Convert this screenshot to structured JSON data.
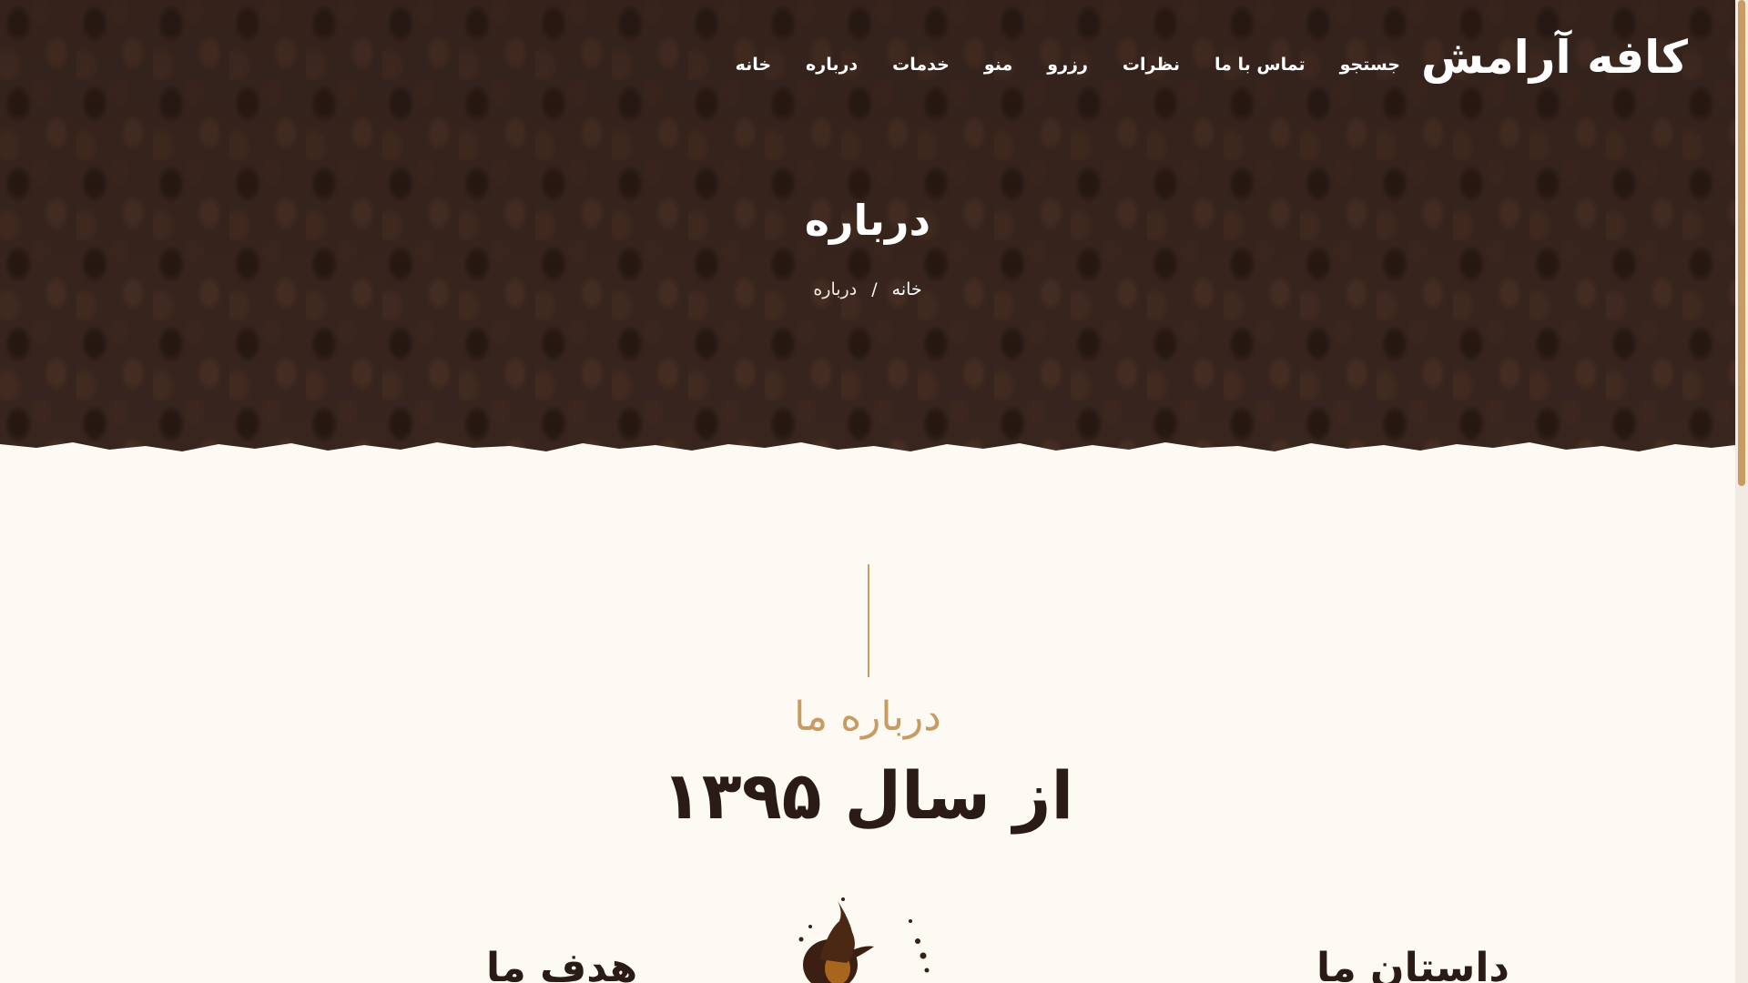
{
  "header": {
    "brand": "کافه آرامش",
    "nav": [
      "خانه",
      "درباره",
      "خدمات",
      "منو",
      "رزرو",
      "نظرات",
      "تماس با ما",
      "جستجو"
    ]
  },
  "hero": {
    "title": "درباره",
    "breadcrumb": {
      "home": "خانه",
      "separator": "/",
      "current": "درباره"
    }
  },
  "about": {
    "kicker": "درباره ما",
    "title": "از سال ۱۳۹۵",
    "col_left_heading": "هدف ما",
    "col_right_heading": "داستان ما"
  },
  "colors": {
    "hero_bg": "#3a2720",
    "page_bg": "#fdf9f3",
    "accent": "#c89b63",
    "text_dark": "#2a1b16"
  }
}
